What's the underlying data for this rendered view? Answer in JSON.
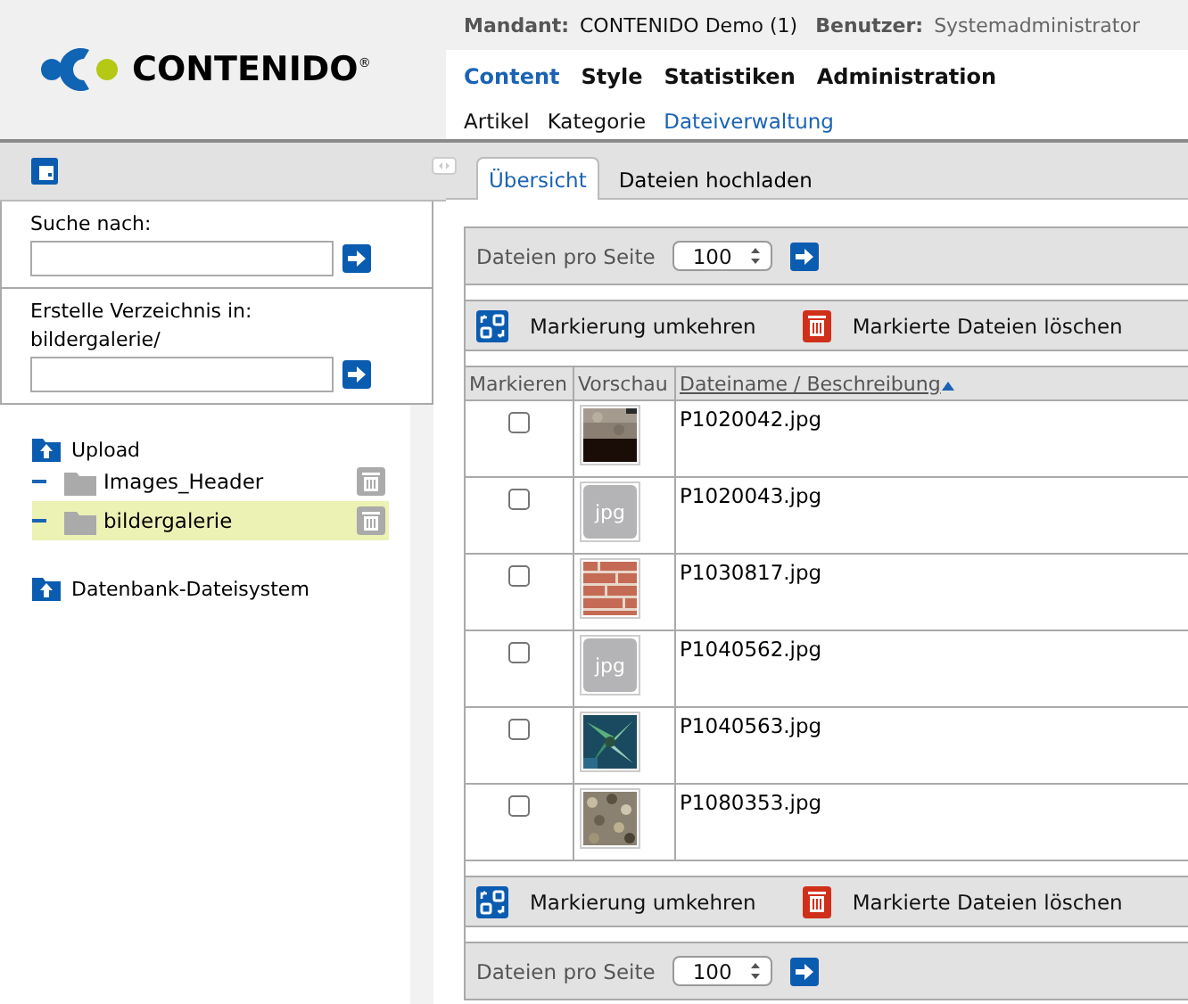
{
  "logo": {
    "text": "CONTENIDO",
    "mark": "®"
  },
  "header": {
    "mandant_label": "Mandant:",
    "mandant": "CONTENIDO Demo (1)",
    "user_label": "Benutzer:",
    "user": "Systemadministrator"
  },
  "main_nav": [
    {
      "label": "Content",
      "selected": true
    },
    {
      "label": "Style",
      "selected": false
    },
    {
      "label": "Statistiken",
      "selected": false
    },
    {
      "label": "Administration",
      "selected": false
    }
  ],
  "sub_nav": [
    {
      "label": "Artikel",
      "selected": false
    },
    {
      "label": "Kategorie",
      "selected": false
    },
    {
      "label": "Dateiverwaltung",
      "selected": true
    }
  ],
  "sidebar": {
    "search_label": "Suche nach:",
    "create_label": "Erstelle Verzeichnis in:",
    "create_path": "bildergalerie/",
    "tree": [
      {
        "label": "Upload",
        "children": [
          {
            "label": "Images_Header",
            "selected": false
          },
          {
            "label": "bildergalerie",
            "selected": true
          }
        ]
      },
      {
        "label": "Datenbank-Dateisystem"
      }
    ]
  },
  "tabs": [
    {
      "label": "Übersicht",
      "selected": true
    },
    {
      "label": "Dateien hochladen",
      "selected": false
    }
  ],
  "top_pager": {
    "label": "Dateien pro Seite",
    "value": "100"
  },
  "top_actions": {
    "invert": "Markierung umkehren",
    "delete": "Markierte Dateien löschen"
  },
  "table": {
    "columns": [
      {
        "label": "Markieren",
        "sorted": false
      },
      {
        "label": "Vorschau",
        "sorted": false
      },
      {
        "label": "Dateiname / Beschreibung",
        "sorted": true
      }
    ],
    "rows": [
      {
        "checked": false,
        "filename": "P1020042.jpg"
      },
      {
        "checked": false,
        "preview": {
          "kind": "file-icon",
          "text": "jpg"
        },
        "filename": "P1020043.jpg"
      },
      {
        "checked": false,
        "filename": "P1030817.jpg"
      },
      {
        "checked": false,
        "preview": {
          "kind": "file-icon",
          "text": "jpg"
        },
        "filename": "P1040562.jpg"
      },
      {
        "checked": false,
        "filename": "P1040563.jpg"
      },
      {
        "checked": false,
        "filename": "P1080353.jpg"
      }
    ]
  },
  "bottom_actions": {
    "invert": "Markierung umkehren",
    "delete": "Markierte Dateien löschen"
  },
  "bottom_pager": {
    "label": "Dateien pro Seite",
    "value": "100"
  }
}
